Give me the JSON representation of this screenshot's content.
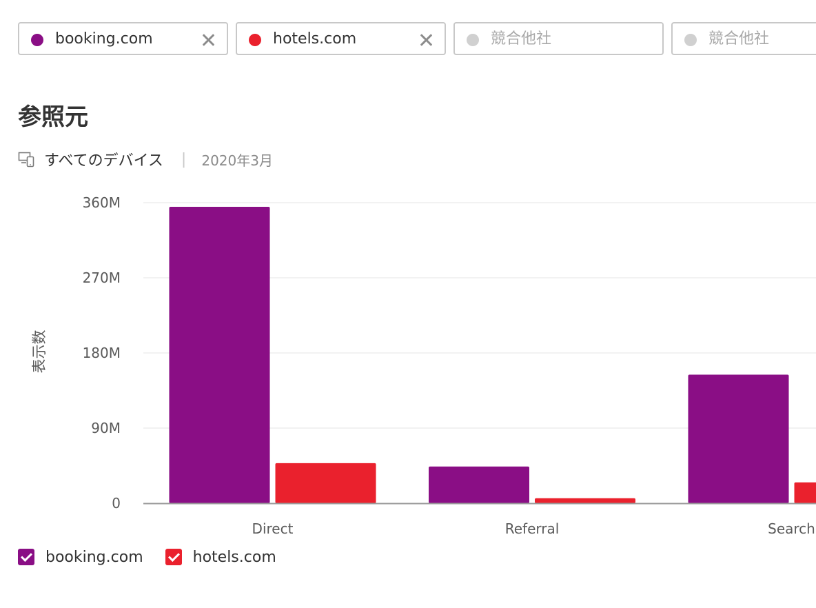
{
  "chips": [
    {
      "label": "booking.com",
      "color": "#8a0e85",
      "closable": true,
      "placeholder": false
    },
    {
      "label": "hotels.com",
      "color": "#ea212d",
      "closable": true,
      "placeholder": false
    },
    {
      "label": "競合他社",
      "color": "#d0d0d0",
      "closable": false,
      "placeholder": true
    },
    {
      "label": "競合他社",
      "color": "#d0d0d0",
      "closable": false,
      "placeholder": true
    }
  ],
  "header": {
    "title": "参照元",
    "device": "すべてのデバイス",
    "separator": "|",
    "date": "2020年3月"
  },
  "icons": {
    "device": "devices-icon",
    "close": "close-icon",
    "check": "check-icon"
  },
  "colors": {
    "booking": "#8a0e85",
    "hotels": "#ea212d",
    "grid": "#e4e4e4",
    "axis": "#9a9a9a"
  },
  "chart_data": {
    "type": "bar",
    "title": "",
    "xlabel": "",
    "ylabel": "表示数",
    "categories": [
      "Direct",
      "Referral",
      "Search"
    ],
    "series": [
      {
        "name": "booking.com",
        "color": "#8a0e85",
        "values": [
          355000000,
          44000000,
          154000000
        ]
      },
      {
        "name": "hotels.com",
        "color": "#ea212d",
        "values": [
          48000000,
          6000000,
          25000000
        ]
      }
    ],
    "yticks": [
      0,
      90000000,
      180000000,
      270000000,
      360000000
    ],
    "ytick_labels": [
      "0",
      "90M",
      "180M",
      "270M",
      "360M"
    ],
    "ylim": [
      0,
      360000000
    ],
    "grid": true,
    "legend_position": "bottom-left"
  },
  "legend": [
    {
      "label": "booking.com",
      "color": "#8a0e85",
      "checked": true
    },
    {
      "label": "hotels.com",
      "color": "#ea212d",
      "checked": true
    }
  ]
}
